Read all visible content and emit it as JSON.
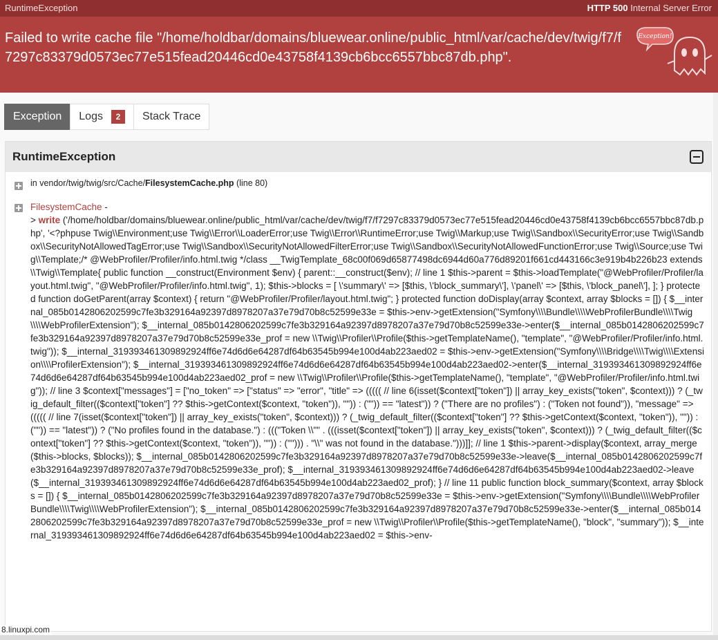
{
  "topbar": {
    "exception_class": "RuntimeException",
    "status_code": "HTTP 500",
    "status_text": "Internal Server Error"
  },
  "header": {
    "message": "Failed to write cache file \"/home/holdbar/domains/bluewear.online/public_html/var/cache/dev/twig/f7/f7297c83379d0573ec77e515fead20446cd0e43758f4139cb6bcc6557bbc87db.php\".",
    "mascot_text": "Exception!"
  },
  "tabs": [
    {
      "label": "Exception"
    },
    {
      "label": "Logs",
      "badge": "2"
    },
    {
      "label": "Stack Trace"
    }
  ],
  "panel": {
    "title": "RuntimeException",
    "location_prefix": "in vendor/twig/twig/src/Cache/",
    "location_file": "FilesystemCache.php",
    "location_suffix": "(line 80)",
    "trace_class": "FilesystemCache",
    "trace_sep": " -",
    "trace_arrow": "> ",
    "trace_function": "write",
    "trace_args": "('/home/holdbar/domains/bluewear.online/public_html/var/cache/dev/twig/f7/f7297c83379d0573ec77e515fead20446cd0e43758f4139cb6bcc6557bbc87db.php', '<?phpuse Twig\\\\Environment;use Twig\\\\Error\\\\LoaderError;use Twig\\\\Error\\\\RuntimeError;use Twig\\\\Markup;use Twig\\\\Sandbox\\\\SecurityError;use Twig\\\\Sandbox\\\\SecurityNotAllowedTagError;use Twig\\\\Sandbox\\\\SecurityNotAllowedFilterError;use Twig\\\\Sandbox\\\\SecurityNotAllowedFunctionError;use Twig\\\\Source;use Twig\\\\Template;/* @WebProfiler/Profiler/info.html.twig */class __TwigTemplate_68c00f069d65877498dc6944d60a776d89201f661cd443166c3e919b4b226b23 extends \\\\Twig\\\\Template{ public function __construct(Environment $env) { parent::__construct($env); // line 1 $this->parent = $this->loadTemplate(\"@WebProfiler/Profiler/layout.html.twig\", \"@WebProfiler/Profiler/info.html.twig\", 1); $this->blocks = [ \\'summary\\' => [$this, \\'block_summary\\'], \\'panel\\' => [$this, \\'block_panel\\'], ]; } protected function doGetParent(array $context) { return \"@WebProfiler/Profiler/layout.html.twig\"; } protected function doDisplay(array $context, array $blocks = []) { $__internal_085b0142806202599c7fe3b329164a92397d8978207a37e79d70b8c52599e33e = $this->env->getExtension(\"Symfony\\\\\\\\Bundle\\\\\\\\WebProfilerBundle\\\\\\\\Twig\\\\\\\\WebProfilerExtension\"); $__internal_085b0142806202599c7fe3b329164a92397d8978207a37e79d70b8c52599e33e->enter($__internal_085b0142806202599c7fe3b329164a92397d8978207a37e79d70b8c52599e33e_prof = new \\\\Twig\\\\Profiler\\\\Profile($this->getTemplateName(), \"template\", \"@WebProfiler/Profiler/info.html.twig\")); $__internal_319393461309892924ff6e74d6d6e64287df64b63545b994e100d4ab223aed02 = $this->env->getExtension(\"Symfony\\\\\\\\Bridge\\\\\\\\Twig\\\\\\\\Extension\\\\\\\\ProfilerExtension\"); $__internal_319393461309892924ff6e74d6d6e64287df64b63545b994e100d4ab223aed02->enter($__internal_319393461309892924ff6e74d6d6e64287df64b63545b994e100d4ab223aed02_prof = new \\\\Twig\\\\Profiler\\\\Profile($this->getTemplateName(), \"template\", \"@WebProfiler/Profiler/info.html.twig\")); // line 3 $context[\"messages\"] = [\"no_token\" => [\"status\" => \"error\", \"title\" => ((((( // line 6(isset($context[\"token\"]) || array_key_exists(\"token\", $context))) ? (_twig_default_filter(($context[\"token\"] ?? $this->getContext($context, \"token\")), \"\")) : (\"\")) == \"latest\")) ? (\"There are no profiles\") : (\"Token not found\")), \"message\" => ((((( // line 7(isset($context[\"token\"]) || array_key_exists(\"token\", $context))) ? (_twig_default_filter(($context[\"token\"] ?? $this->getContext($context, \"token\")), \"\")) : (\"\")) == \"latest\")) ? (\"No profiles found in the database.\") : (((\"Token \\\\\"\" . (((isset($context[\"token\"]) || array_key_exists(\"token\", $context))) ? (_twig_default_filter(($context[\"token\"] ?? $this->getContext($context, \"token\")), \"\")) : (\"\"))) . \"\\\\\" was not found in the database.\")))]]; // line 1 $this->parent->display($context, array_merge($this->blocks, $blocks)); $__internal_085b0142806202599c7fe3b329164a92397d8978207a37e79d70b8c52599e33e->leave($__internal_085b0142806202599c7fe3b329164a92397d8978207a37e79d70b8c52599e33e_prof); $__internal_319393461309892924ff6e74d6d6e64287df64b63545b994e100d4ab223aed02->leave($__internal_319393461309892924ff6e74d6d6e64287df64b63545b994e100d4ab223aed02_prof); } // line 11 public function block_summary($context, array $blocks = []) { $__internal_085b0142806202599c7fe3b329164a92397d8978207a37e79d70b8c52599e33e = $this->env->getExtension(\"Symfony\\\\\\\\Bundle\\\\\\\\WebProfilerBundle\\\\\\\\Twig\\\\\\\\WebProfilerExtension\"); $__internal_085b0142806202599c7fe3b329164a92397d8978207a37e79d70b8c52599e33e->enter($__internal_085b0142806202599c7fe3b329164a92397d8978207a37e79d70b8c52599e33e_prof = new \\\\Twig\\\\Profiler\\\\Profile($this->getTemplateName(), \"block\", \"summary\")); $__internal_319393461309892924ff6e74d6d6e64287df64b63545b994e100d4ab223aed02 = $this->env-"
  },
  "footer": {
    "url": "8.linuxpi.com"
  },
  "colors": {
    "topbar": "#8f2f2f",
    "header": "#b0413e",
    "active_tab": "#666666",
    "badge": "#b0413e"
  },
  "icons": {
    "collapse": "minus-square-icon",
    "expand": "plus-square-icon",
    "mascot": "ghost-icon"
  }
}
